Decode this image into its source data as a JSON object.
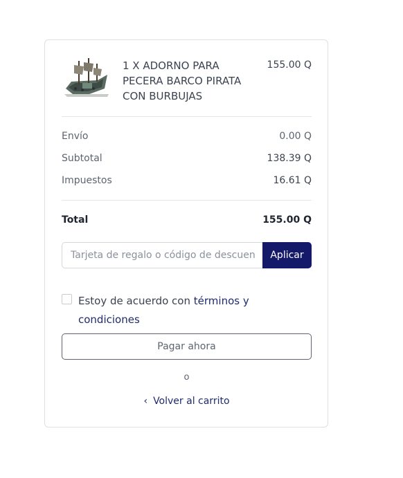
{
  "cart_item": {
    "name": "1 x ADORNO PARA PECERA BARCO PIRATA CON BURBUJAS",
    "price": "155.00 Q",
    "image_icon": "pirate-ship-ornament"
  },
  "summary": {
    "shipping": {
      "label": "Envío",
      "value": "0.00 Q"
    },
    "subtotal": {
      "label": "Subtotal",
      "value": "138.39 Q"
    },
    "taxes": {
      "label": "Impuestos",
      "value": "16.61 Q"
    },
    "total": {
      "label": "Total",
      "value": "155.00 Q"
    }
  },
  "discount": {
    "placeholder": "Tarjeta de regalo o código de descuento",
    "value": "",
    "apply_label": "Aplicar"
  },
  "terms": {
    "checked": false,
    "text": "Estoy de acuerdo con",
    "link": "términos y condiciones"
  },
  "actions": {
    "pay_label": "Pagar ahora",
    "or_label": "o",
    "back_label": "Volver al carrito",
    "back_icon": "chevron-left"
  },
  "colors": {
    "accent": "#15196a",
    "link": "#1f2a6e",
    "border": "#dcdfe4"
  }
}
